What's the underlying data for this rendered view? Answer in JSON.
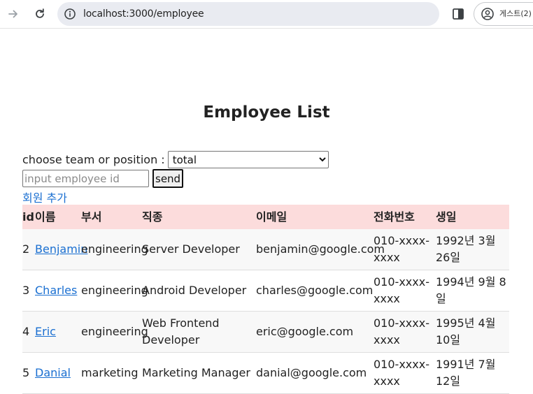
{
  "browser": {
    "url": "localhost:3000/employee",
    "profile_label": "게스트(2)"
  },
  "page": {
    "title": "Employee List",
    "filter_label": "choose team or position :",
    "filter_selected": "total",
    "id_placeholder": "input employee id",
    "send_label": "send",
    "add_link": "회원 추가"
  },
  "table": {
    "headers": {
      "id": "id",
      "name": "이름",
      "dept": "부서",
      "job": "직종",
      "email": "이메일",
      "phone": "전화번호",
      "birth": "생일"
    },
    "rows": [
      {
        "id": "2",
        "name": "Benjamin",
        "dept": "engineering",
        "job": "Server Developer",
        "email": "benjamin@google.com",
        "phone": "010-xxxx-xxxx",
        "birth": "1992년 3월 26일"
      },
      {
        "id": "3",
        "name": "Charles",
        "dept": "engineering",
        "job": "Android Developer",
        "email": "charles@google.com",
        "phone": "010-xxxx-xxxx",
        "birth": "1994년 9월 8일"
      },
      {
        "id": "4",
        "name": "Eric",
        "dept": "engineering",
        "job": "Web Frontend Developer",
        "email": "eric@google.com",
        "phone": "010-xxxx-xxxx",
        "birth": "1995년 4월 10일"
      },
      {
        "id": "5",
        "name": "Danial",
        "dept": "marketing",
        "job": "Marketing Manager",
        "email": "danial@google.com",
        "phone": "010-xxxx-xxxx",
        "birth": "1991년 7월 12일"
      }
    ]
  },
  "icons": {
    "back": "arrow-right-icon",
    "reload": "reload-icon",
    "site": "site-info-icon",
    "sidepanel": "side-panel-icon",
    "profile": "person-icon"
  }
}
